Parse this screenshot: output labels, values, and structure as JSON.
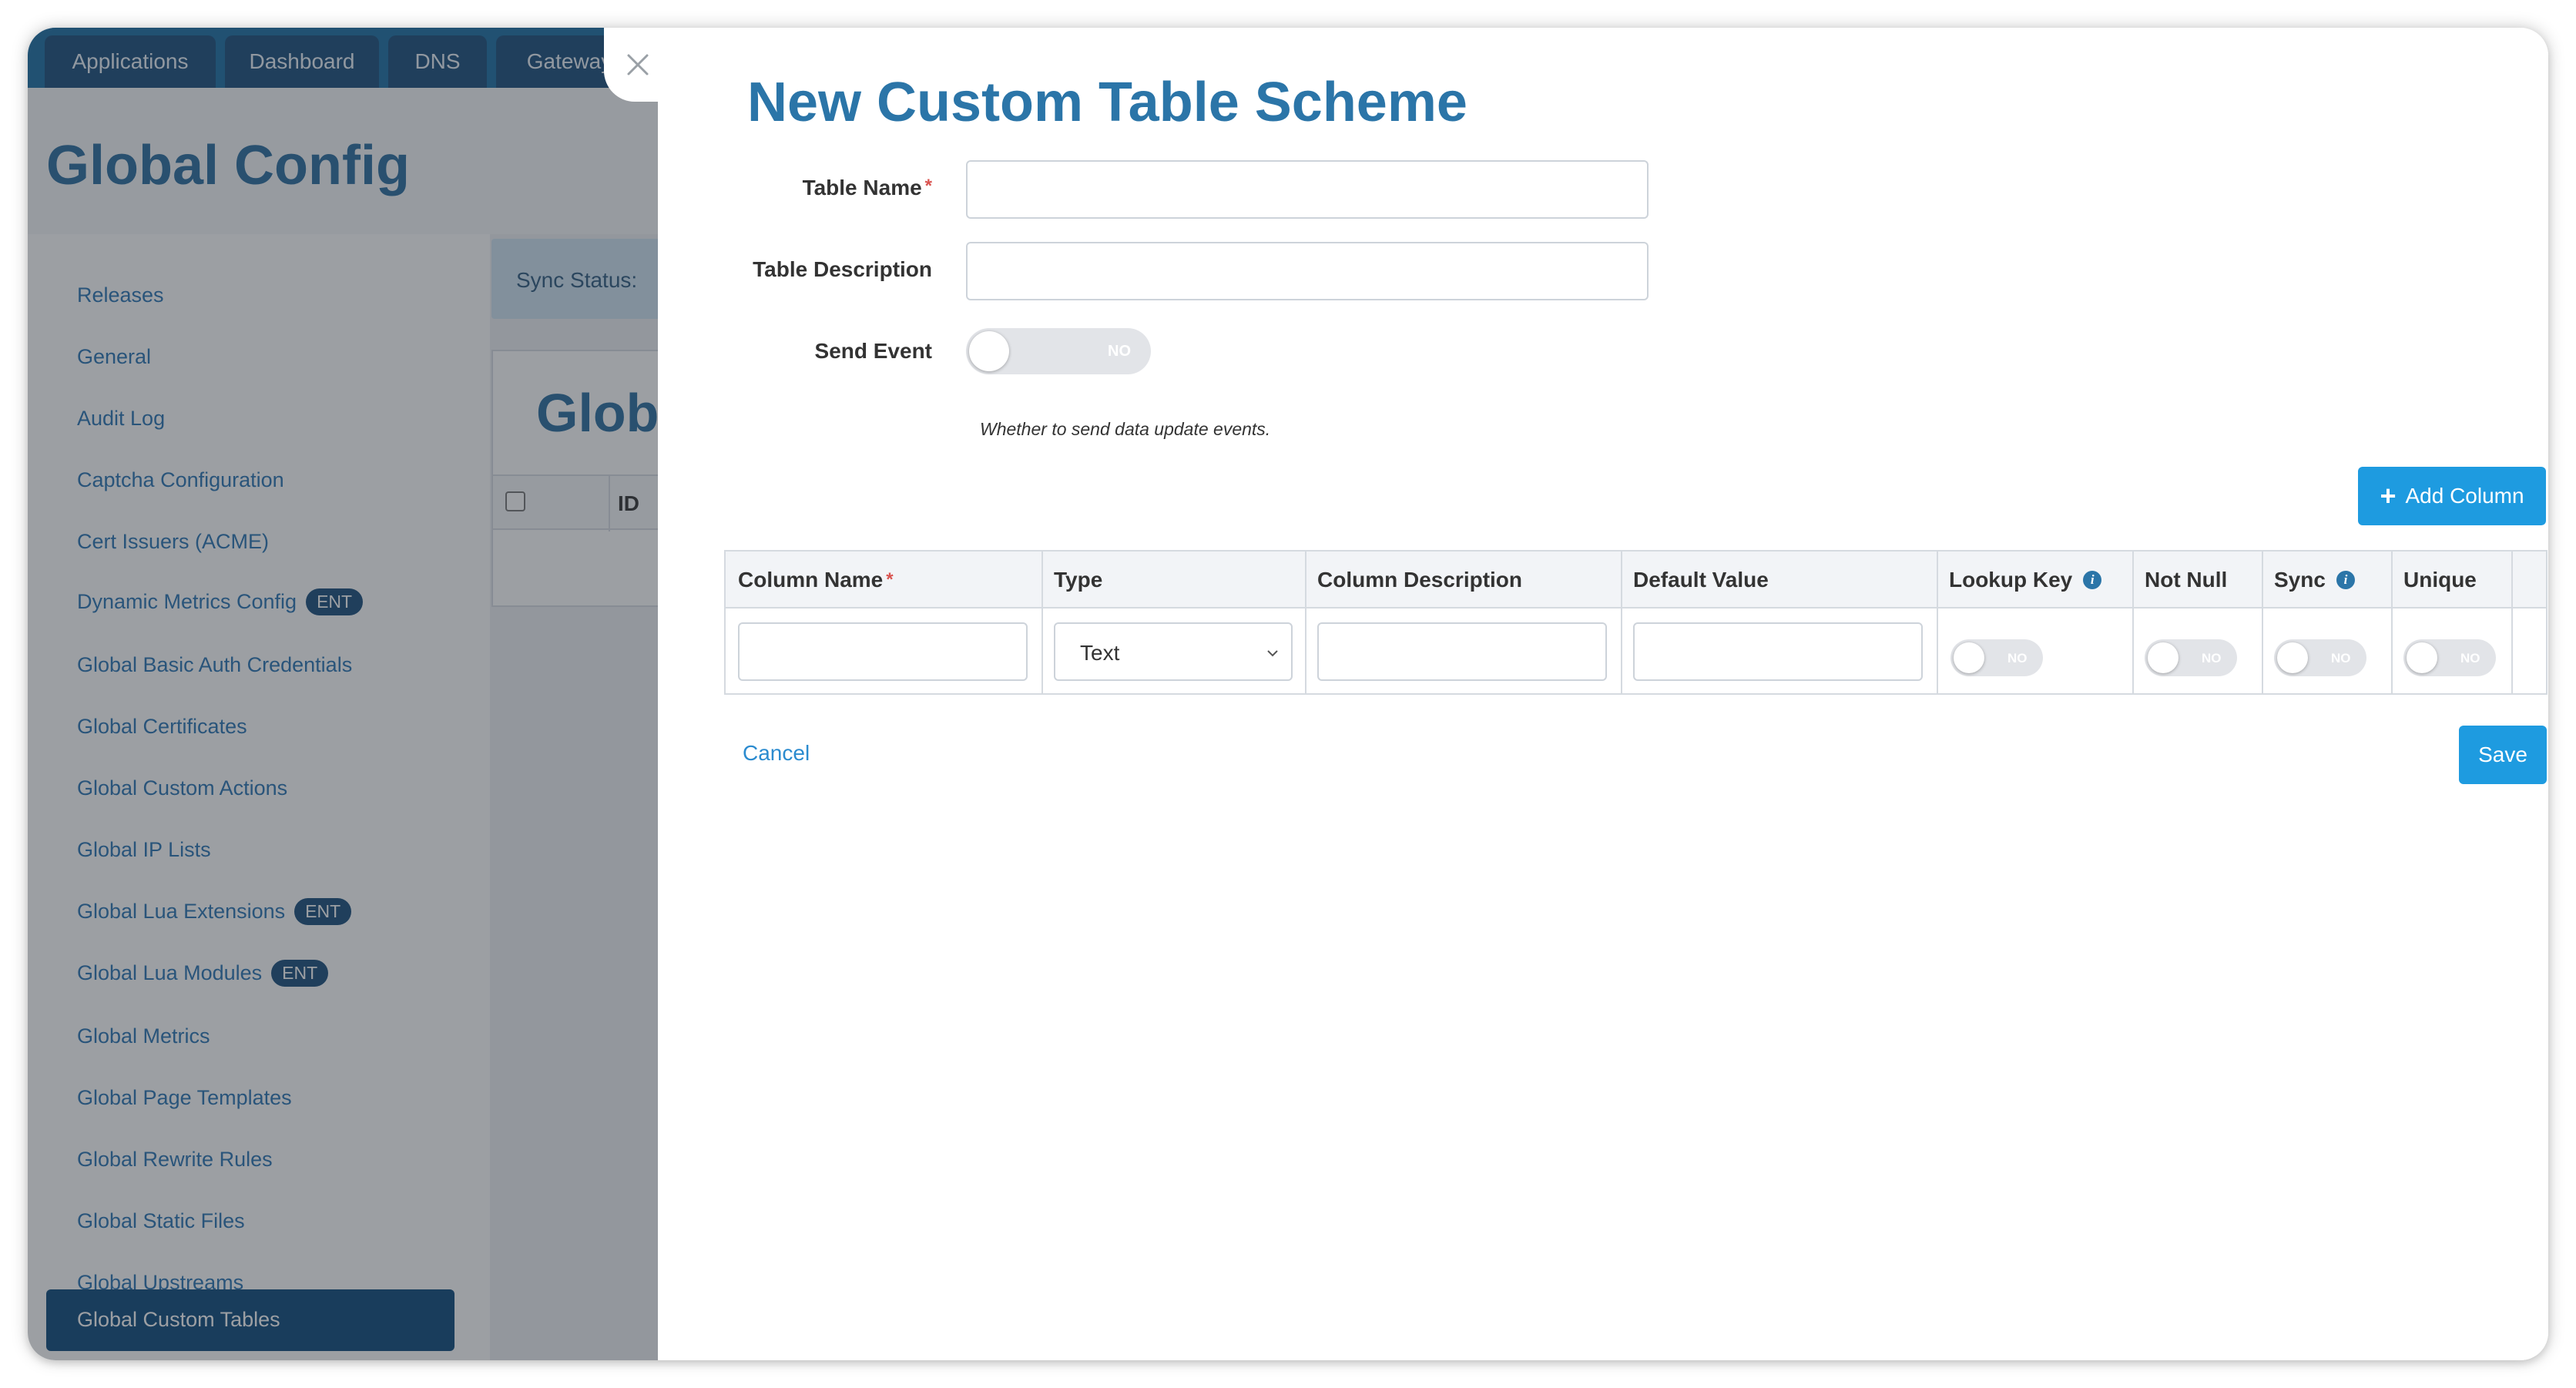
{
  "app": {
    "nav_tabs": [
      "Applications",
      "Dashboard",
      "DNS",
      "Gateway"
    ],
    "page_title": "Global Config",
    "sidebar": {
      "items": [
        {
          "label": "Releases"
        },
        {
          "label": "General"
        },
        {
          "label": "Audit Log"
        },
        {
          "label": "Captcha Configuration"
        },
        {
          "label": "Cert Issuers (ACME)"
        },
        {
          "label": "Dynamic Metrics Config",
          "badge": "ENT"
        },
        {
          "label": "Global Basic Auth Credentials"
        },
        {
          "label": "Global Certificates"
        },
        {
          "label": "Global Custom Actions"
        },
        {
          "label": "Global IP Lists"
        },
        {
          "label": "Global Lua Extensions",
          "badge": "ENT"
        },
        {
          "label": "Global Lua Modules",
          "badge": "ENT"
        },
        {
          "label": "Global Metrics"
        },
        {
          "label": "Global Page Templates"
        },
        {
          "label": "Global Rewrite Rules"
        },
        {
          "label": "Global Static Files"
        },
        {
          "label": "Global Upstreams"
        }
      ],
      "active_item": "Global Custom Tables"
    },
    "content": {
      "sync_status_label": "Sync Status:",
      "card_title": "Glob",
      "table_header_id": "ID"
    }
  },
  "drawer": {
    "title": "New Custom Table Scheme",
    "close_icon": "close-icon",
    "form": {
      "table_name_label": "Table Name",
      "table_description_label": "Table Description",
      "send_event_label": "Send Event",
      "send_event_toggle": "NO",
      "send_event_help": "Whether to send data update events.",
      "required_mark": "*"
    },
    "add_column_label": "Add Column",
    "columns_table": {
      "headers": [
        "Column Name",
        "Type",
        "Column Description",
        "Default Value",
        "Lookup Key",
        "Not Null",
        "Sync",
        "Unique"
      ],
      "row": {
        "type_value": "Text",
        "lookup_key_toggle": "NO",
        "not_null_toggle": "NO",
        "sync_toggle": "NO",
        "unique_toggle": "NO"
      }
    },
    "cancel_label": "Cancel",
    "save_label": "Save"
  },
  "colors": {
    "accent": "#1e9be0",
    "title_blue": "#2b75a8",
    "nav_dark": "#1a4f7c",
    "sidebar_active": "#0d4a7d",
    "required": "#d9534f"
  }
}
